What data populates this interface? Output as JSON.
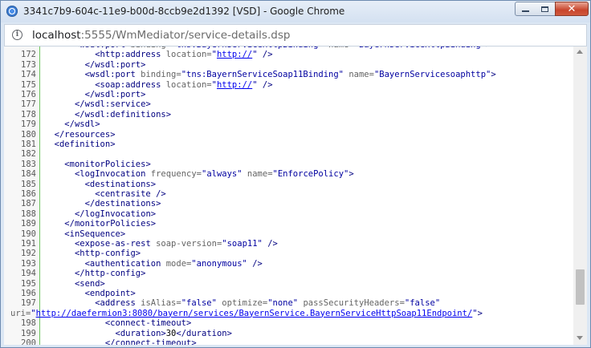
{
  "window": {
    "title": "3341c7b9-604c-11e9-b00d-8ccb9e2d1392 [VSD] - Google Chrome",
    "close_glyph": "✕"
  },
  "address": {
    "host": "localhost",
    "rest": ":5555/WmMediator/service-details.dsp",
    "icon": "info-icon"
  },
  "code_lines": [
    {
      "n": "",
      "h": "      <span class=\"t\">&lt;wsdl:port</span> <span class=\"a\">binding=</span><span class=\"v\">\"tns:BayernServiceHttpBinding\"</span> <span class=\"a\">name=</span><span class=\"v\">\"BayernServiceHttpBinding\"</span><span class=\"t\">&gt;</span>"
    },
    {
      "n": "172",
      "h": "          <span class=\"t\">&lt;http:address</span> <span class=\"a\">location=</span><span class=\"v\">\"<span class=\"link\">http://</span>\"</span> <span class=\"t\">/&gt;</span>"
    },
    {
      "n": "173",
      "h": "        <span class=\"t\">&lt;/wsdl:port&gt;</span>"
    },
    {
      "n": "174",
      "h": "        <span class=\"t\">&lt;wsdl:port</span> <span class=\"a\">binding=</span><span class=\"v\">\"tns:BayernServiceSoap11Binding\"</span> <span class=\"a\">name=</span><span class=\"v\">\"BayernServicesoaphttp\"</span><span class=\"t\">&gt;</span>"
    },
    {
      "n": "175",
      "h": "          <span class=\"t\">&lt;soap:address</span> <span class=\"a\">location=</span><span class=\"v\">\"<span class=\"link\">http://</span>\"</span> <span class=\"t\">/&gt;</span>"
    },
    {
      "n": "176",
      "h": "        <span class=\"t\">&lt;/wsdl:port&gt;</span>"
    },
    {
      "n": "177",
      "h": "      <span class=\"t\">&lt;/wsdl:service&gt;</span>"
    },
    {
      "n": "178",
      "h": "      <span class=\"t\">&lt;/wsdl:definitions&gt;</span>"
    },
    {
      "n": "179",
      "h": "    <span class=\"t\">&lt;/wsdl&gt;</span>"
    },
    {
      "n": "180",
      "h": "  <span class=\"t\">&lt;/resources&gt;</span>"
    },
    {
      "n": "181",
      "h": "  <span class=\"t\">&lt;definition&gt;</span>"
    },
    {
      "n": "182",
      "h": ""
    },
    {
      "n": "183",
      "h": "    <span class=\"t\">&lt;monitorPolicies&gt;</span>"
    },
    {
      "n": "184",
      "h": "      <span class=\"t\">&lt;logInvocation</span> <span class=\"a\">frequency=</span><span class=\"v\">\"always\"</span> <span class=\"a\">name=</span><span class=\"v\">\"EnforcePolicy\"</span><span class=\"t\">&gt;</span>"
    },
    {
      "n": "185",
      "h": "        <span class=\"t\">&lt;destinations&gt;</span>"
    },
    {
      "n": "186",
      "h": "          <span class=\"t\">&lt;centrasite /&gt;</span>"
    },
    {
      "n": "187",
      "h": "        <span class=\"t\">&lt;/destinations&gt;</span>"
    },
    {
      "n": "188",
      "h": "      <span class=\"t\">&lt;/logInvocation&gt;</span>"
    },
    {
      "n": "189",
      "h": "    <span class=\"t\">&lt;/monitorPolicies&gt;</span>"
    },
    {
      "n": "190",
      "h": "    <span class=\"t\">&lt;inSequence&gt;</span>"
    },
    {
      "n": "191",
      "h": "      <span class=\"t\">&lt;expose-as-rest</span> <span class=\"a\">soap-version=</span><span class=\"v\">\"soap11\"</span> <span class=\"t\">/&gt;</span>"
    },
    {
      "n": "192",
      "h": "      <span class=\"t\">&lt;http-config&gt;</span>"
    },
    {
      "n": "193",
      "h": "        <span class=\"t\">&lt;authentication</span> <span class=\"a\">mode=</span><span class=\"v\">\"anonymous\"</span> <span class=\"t\">/&gt;</span>"
    },
    {
      "n": "194",
      "h": "      <span class=\"t\">&lt;/http-config&gt;</span>"
    },
    {
      "n": "195",
      "h": "      <span class=\"t\">&lt;send&gt;</span>"
    },
    {
      "n": "196",
      "h": "        <span class=\"t\">&lt;endpoint&gt;</span>"
    },
    {
      "n": "197",
      "h": "          <span class=\"t\">&lt;address</span> <span class=\"a\">isAlias=</span><span class=\"v\">\"false\"</span> <span class=\"a\">optimize=</span><span class=\"v\">\"none\"</span> <span class=\"a\">passSecurityHeaders=</span><span class=\"v\">\"false\"</span>"
    },
    {
      "n": "",
      "h": "<span class=\"a\">uri=</span><span class=\"v\">\"<span class=\"link\">http://daefermion3:8080/bayern/services/BayernService.BayernServiceHttpSoap11Endpoint/</span>\"</span><span class=\"t\">&gt;</span>",
      "wrap": true
    },
    {
      "n": "198",
      "h": "            <span class=\"t\">&lt;connect-timeout&gt;</span>"
    },
    {
      "n": "199",
      "h": "              <span class=\"t\">&lt;duration&gt;</span>30<span class=\"t\">&lt;/duration&gt;</span>"
    },
    {
      "n": "200",
      "h": "            <span class=\"t\">&lt;/connect-timeout&gt;</span>"
    }
  ]
}
